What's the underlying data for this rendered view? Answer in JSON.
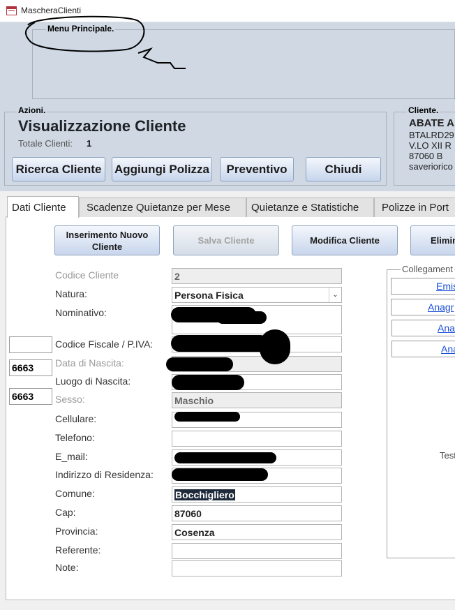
{
  "window": {
    "title": "MascheraClienti"
  },
  "menu_group": {
    "label": "Menu Principale."
  },
  "azioni": {
    "label": "Azioni.",
    "title": "Visualizzazione Cliente",
    "totale_label": "Totale Clienti:",
    "totale_value": "1",
    "buttons": [
      "Ricerca Cliente",
      "Aggiungi Polizza",
      "Preventivo",
      "Chiudi"
    ]
  },
  "cliente_panel": {
    "label": "Cliente.",
    "name": "ABATE A",
    "lines": [
      "BTALRD29",
      "V.LO XII R",
      "87060     B",
      "saveriorico"
    ]
  },
  "tabs": [
    {
      "label": "Dati Cliente",
      "active": true
    },
    {
      "label": "Scadenze Quietanze per Mese"
    },
    {
      "label": "Quietanze e Statistiche"
    },
    {
      "label": "Polizze in Port"
    }
  ],
  "form_buttons": [
    {
      "label": "Inserimento Nuovo\nCliente",
      "enabled": true
    },
    {
      "label": "Salva Cliente",
      "enabled": false
    },
    {
      "label": "Modifica Cliente",
      "enabled": true
    },
    {
      "label": "Elimin",
      "enabled": true
    }
  ],
  "fields": [
    {
      "label": "Codice Cliente",
      "value": "2",
      "readonly": true
    },
    {
      "label": "Natura:",
      "value": "Persona Fisica",
      "type": "combo"
    },
    {
      "label": "Nominativo:",
      "value": ""
    },
    {
      "label": "Codice Fiscale / P.IVA:",
      "value": ""
    },
    {
      "label": "Data di Nascita:",
      "value": "",
      "readonly": true
    },
    {
      "label": "Luogo di Nascita:",
      "value": ""
    },
    {
      "label": "Sesso:",
      "value": "Maschio",
      "readonly": true
    },
    {
      "label": "Cellulare:",
      "value": ""
    },
    {
      "label": "Telefono:",
      "value": ""
    },
    {
      "label": "E_mail:",
      "value": ""
    },
    {
      "label": "Indirizzo di Residenza:",
      "value": ""
    },
    {
      "label": "Comune:",
      "value": "Bocchigliero",
      "selected": true
    },
    {
      "label": "Cap:",
      "value": "87060"
    },
    {
      "label": "Provincia:",
      "value": "Cosenza"
    },
    {
      "label": "Referente:",
      "value": ""
    },
    {
      "label": "Note:",
      "value": ""
    }
  ],
  "side_boxes": [
    "",
    "6663",
    "6663"
  ],
  "collegamenti": {
    "label": "Collegament",
    "links": [
      "Emis",
      "Anagr",
      "Ana",
      "Ana"
    ],
    "testo": "Test"
  },
  "colors": {
    "header_bg": "#cfd8e3",
    "button_top": "#f4f7fc",
    "button_bottom": "#c7d5ec",
    "link": "#1a4fd8"
  }
}
